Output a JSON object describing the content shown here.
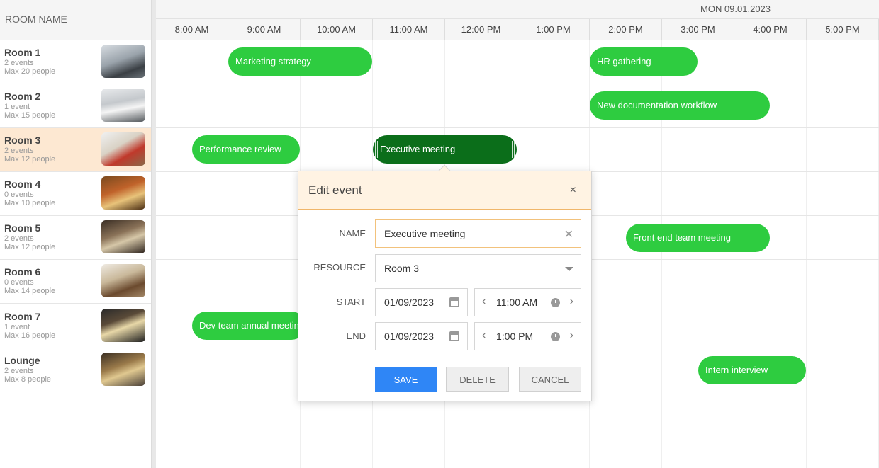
{
  "sidebar": {
    "header": "ROOM NAME",
    "rooms": [
      {
        "name": "Room 1",
        "events": "2 events",
        "max": "Max 20 people"
      },
      {
        "name": "Room 2",
        "events": "1 event",
        "max": "Max 15 people"
      },
      {
        "name": "Room 3",
        "events": "2 events",
        "max": "Max 12 people"
      },
      {
        "name": "Room 4",
        "events": "0 events",
        "max": "Max 10 people"
      },
      {
        "name": "Room 5",
        "events": "2 events",
        "max": "Max 12 people"
      },
      {
        "name": "Room 6",
        "events": "0 events",
        "max": "Max 14 people"
      },
      {
        "name": "Room 7",
        "events": "1 event",
        "max": "Max 16 people"
      },
      {
        "name": "Lounge",
        "events": "2 events",
        "max": "Max 8 people"
      }
    ]
  },
  "timeline": {
    "date": "MON 09.01.2023",
    "hours": [
      "8:00 AM",
      "9:00 AM",
      "10:00 AM",
      "11:00 AM",
      "12:00 PM",
      "1:00 PM",
      "2:00 PM",
      "3:00 PM",
      "4:00 PM",
      "5:00 PM"
    ]
  },
  "events": [
    {
      "title": "Marketing strategy"
    },
    {
      "title": "HR gathering"
    },
    {
      "title": "New documentation workflow"
    },
    {
      "title": "Performance review"
    },
    {
      "title": "Executive meeting"
    },
    {
      "title": "Front end team meeting"
    },
    {
      "title": "Dev team annual meeting"
    },
    {
      "title": "Intern interview"
    }
  ],
  "popup": {
    "title": "Edit event",
    "close": "×",
    "name_label": "NAME",
    "name_value": "Executive meeting",
    "resource_label": "RESOURCE",
    "resource_value": "Room 3",
    "start_label": "START",
    "start_date": "01/09/2023",
    "start_time": "11:00 AM",
    "end_label": "END",
    "end_date": "01/09/2023",
    "end_time": "1:00 PM",
    "save": "SAVE",
    "delete": "DELETE",
    "cancel": "CANCEL"
  },
  "colors": {
    "event": "#2ecc40",
    "event_selected": "#0b6e1a",
    "selected_row": "#fde8d2",
    "primary_button": "#2f86f6"
  }
}
